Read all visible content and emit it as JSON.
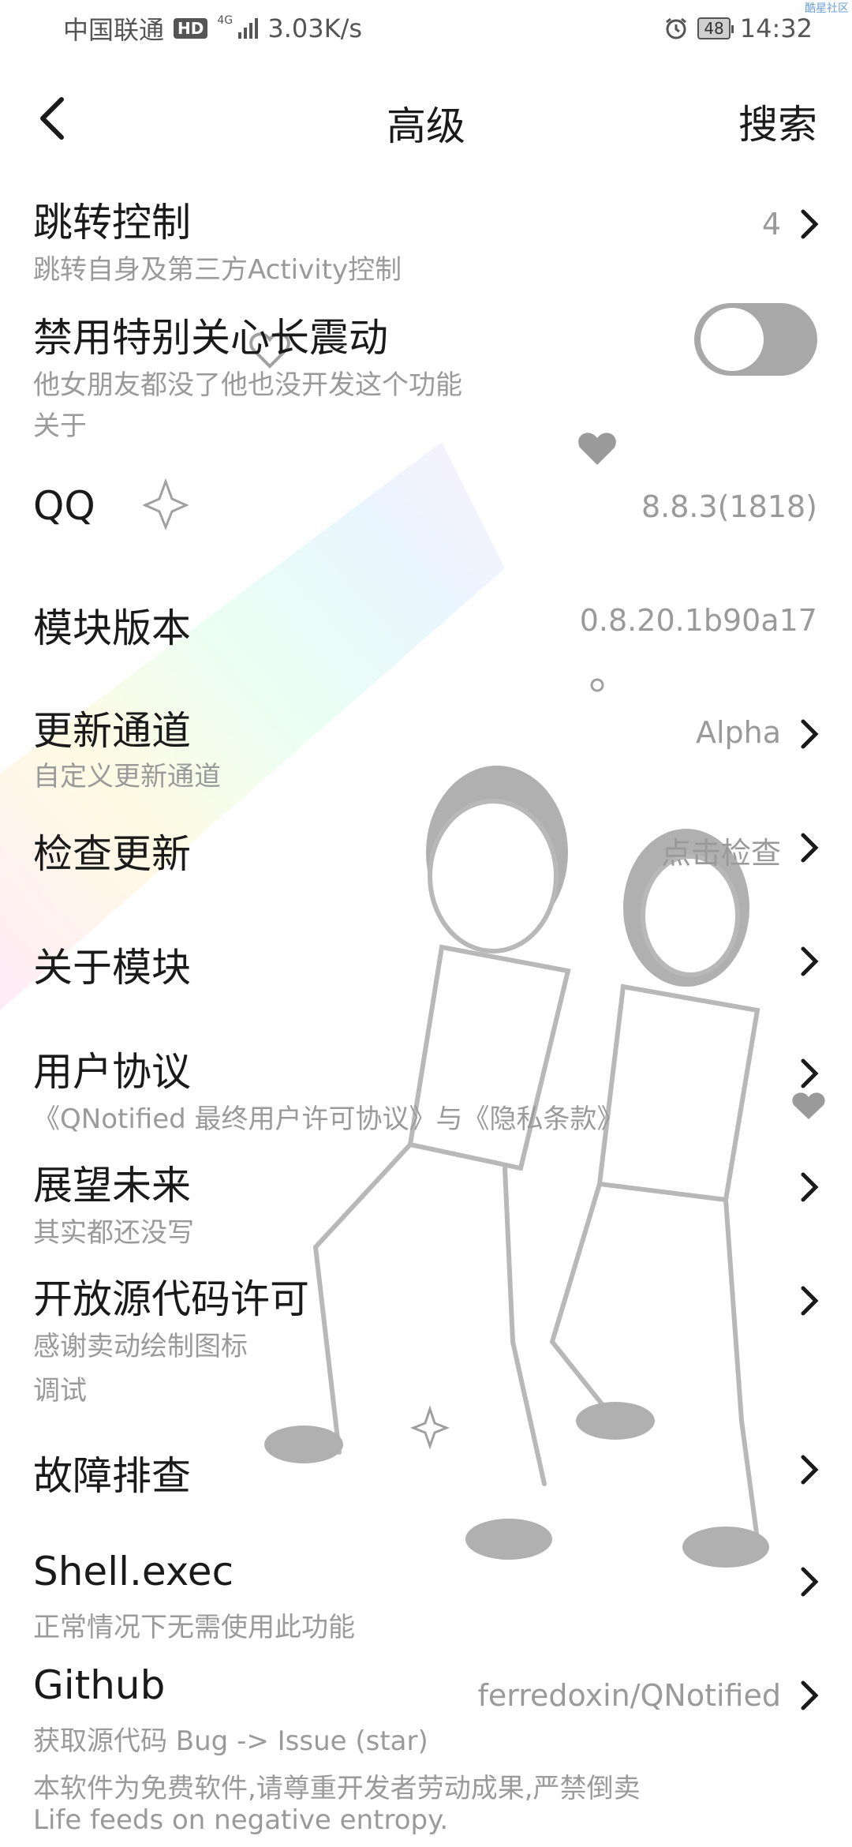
{
  "status_bar": {
    "carrier": "中国联通",
    "hd": "HD",
    "network": "4G",
    "speed": "3.03K/s",
    "battery": "48",
    "time": "14:32",
    "watermark": "酷星社区"
  },
  "app_bar": {
    "title": "高级",
    "search_label": "搜索"
  },
  "items": [
    {
      "title": "跳转控制",
      "subtitle": "跳转自身及第三方Activity控制",
      "value": "4"
    },
    {
      "title": "禁用特别关心长震动",
      "subtitle": "他女朋友都没了他也没开发这个功能",
      "toggle_on": false
    },
    {
      "section": "关于"
    },
    {
      "title": "QQ",
      "value": "8.8.3(1818)"
    },
    {
      "title": "模块版本",
      "value": "0.8.20.1b90a17"
    },
    {
      "title": "更新通道",
      "subtitle": "自定义更新通道",
      "value": "Alpha"
    },
    {
      "title": "检查更新",
      "value": "点击检查"
    },
    {
      "title": "关于模块"
    },
    {
      "title": "用户协议",
      "subtitle": "《QNotified 最终用户许可协议》与《隐私条款》"
    },
    {
      "title": "展望未来",
      "subtitle": "其实都还没写"
    },
    {
      "title": "开放源代码许可",
      "subtitle": "感谢卖动绘制图标"
    },
    {
      "section": "调试"
    },
    {
      "title": "故障排查"
    },
    {
      "title": "Shell.exec",
      "subtitle": "正常情况下无需使用此功能"
    },
    {
      "title": "Github",
      "subtitle": "获取源代码 Bug -> Issue (star)",
      "value": "ferredoxin/QNotified"
    }
  ],
  "footer": {
    "line1": "本软件为免费软件,请尊重开发者劳动成果,严禁倒卖",
    "line2": "Life feeds on negative entropy."
  },
  "colors": {
    "title": "#1a1a1a",
    "subtitle": "#9a9a9a",
    "toggle_track": "#a8a8a8"
  }
}
